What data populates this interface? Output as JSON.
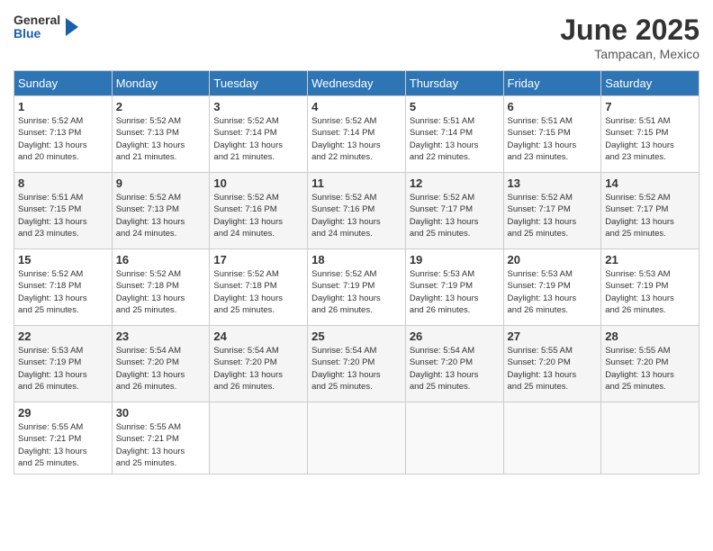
{
  "header": {
    "logo": {
      "general": "General",
      "blue": "Blue"
    },
    "title": "June 2025",
    "location": "Tampacan, Mexico"
  },
  "calendar": {
    "days_of_week": [
      "Sunday",
      "Monday",
      "Tuesday",
      "Wednesday",
      "Thursday",
      "Friday",
      "Saturday"
    ],
    "weeks": [
      [
        null,
        {
          "day": "2",
          "sunrise": "5:52 AM",
          "sunset": "7:13 PM",
          "daylight": "13 hours and 21 minutes."
        },
        {
          "day": "3",
          "sunrise": "5:52 AM",
          "sunset": "7:14 PM",
          "daylight": "13 hours and 21 minutes."
        },
        {
          "day": "4",
          "sunrise": "5:52 AM",
          "sunset": "7:14 PM",
          "daylight": "13 hours and 22 minutes."
        },
        {
          "day": "5",
          "sunrise": "5:51 AM",
          "sunset": "7:14 PM",
          "daylight": "13 hours and 22 minutes."
        },
        {
          "day": "6",
          "sunrise": "5:51 AM",
          "sunset": "7:15 PM",
          "daylight": "13 hours and 23 minutes."
        },
        {
          "day": "7",
          "sunrise": "5:51 AM",
          "sunset": "7:15 PM",
          "daylight": "13 hours and 23 minutes."
        }
      ],
      [
        {
          "day": "1",
          "sunrise": "5:52 AM",
          "sunset": "7:13 PM",
          "daylight": "13 hours and 20 minutes."
        },
        {
          "day": "9",
          "sunrise": "5:52 AM",
          "sunset": "7:13 PM",
          "daylight": "13 hours and 24 minutes."
        },
        {
          "day": "10",
          "sunrise": "5:52 AM",
          "sunset": "7:16 PM",
          "daylight": "13 hours and 24 minutes."
        },
        {
          "day": "11",
          "sunrise": "5:52 AM",
          "sunset": "7:16 PM",
          "daylight": "13 hours and 24 minutes."
        },
        {
          "day": "12",
          "sunrise": "5:52 AM",
          "sunset": "7:17 PM",
          "daylight": "13 hours and 25 minutes."
        },
        {
          "day": "13",
          "sunrise": "5:52 AM",
          "sunset": "7:17 PM",
          "daylight": "13 hours and 25 minutes."
        },
        {
          "day": "14",
          "sunrise": "5:52 AM",
          "sunset": "7:17 PM",
          "daylight": "13 hours and 25 minutes."
        }
      ],
      [
        {
          "day": "8",
          "sunrise": "5:51 AM",
          "sunset": "7:15 PM",
          "daylight": "13 hours and 23 minutes."
        },
        {
          "day": "16",
          "sunrise": "5:52 AM",
          "sunset": "7:18 PM",
          "daylight": "13 hours and 25 minutes."
        },
        {
          "day": "17",
          "sunrise": "5:52 AM",
          "sunset": "7:18 PM",
          "daylight": "13 hours and 25 minutes."
        },
        {
          "day": "18",
          "sunrise": "5:52 AM",
          "sunset": "7:19 PM",
          "daylight": "13 hours and 26 minutes."
        },
        {
          "day": "19",
          "sunrise": "5:53 AM",
          "sunset": "7:19 PM",
          "daylight": "13 hours and 26 minutes."
        },
        {
          "day": "20",
          "sunrise": "5:53 AM",
          "sunset": "7:19 PM",
          "daylight": "13 hours and 26 minutes."
        },
        {
          "day": "21",
          "sunrise": "5:53 AM",
          "sunset": "7:19 PM",
          "daylight": "13 hours and 26 minutes."
        }
      ],
      [
        {
          "day": "15",
          "sunrise": "5:52 AM",
          "sunset": "7:18 PM",
          "daylight": "13 hours and 25 minutes."
        },
        {
          "day": "23",
          "sunrise": "5:54 AM",
          "sunset": "7:20 PM",
          "daylight": "13 hours and 26 minutes."
        },
        {
          "day": "24",
          "sunrise": "5:54 AM",
          "sunset": "7:20 PM",
          "daylight": "13 hours and 26 minutes."
        },
        {
          "day": "25",
          "sunrise": "5:54 AM",
          "sunset": "7:20 PM",
          "daylight": "13 hours and 25 minutes."
        },
        {
          "day": "26",
          "sunrise": "5:54 AM",
          "sunset": "7:20 PM",
          "daylight": "13 hours and 25 minutes."
        },
        {
          "day": "27",
          "sunrise": "5:55 AM",
          "sunset": "7:20 PM",
          "daylight": "13 hours and 25 minutes."
        },
        {
          "day": "28",
          "sunrise": "5:55 AM",
          "sunset": "7:20 PM",
          "daylight": "13 hours and 25 minutes."
        }
      ],
      [
        {
          "day": "22",
          "sunrise": "5:53 AM",
          "sunset": "7:19 PM",
          "daylight": "13 hours and 26 minutes."
        },
        {
          "day": "30",
          "sunrise": "5:55 AM",
          "sunset": "7:21 PM",
          "daylight": "13 hours and 25 minutes."
        },
        null,
        null,
        null,
        null,
        null
      ],
      [
        {
          "day": "29",
          "sunrise": "5:55 AM",
          "sunset": "7:21 PM",
          "daylight": "13 hours and 25 minutes."
        },
        null,
        null,
        null,
        null,
        null,
        null
      ]
    ]
  }
}
